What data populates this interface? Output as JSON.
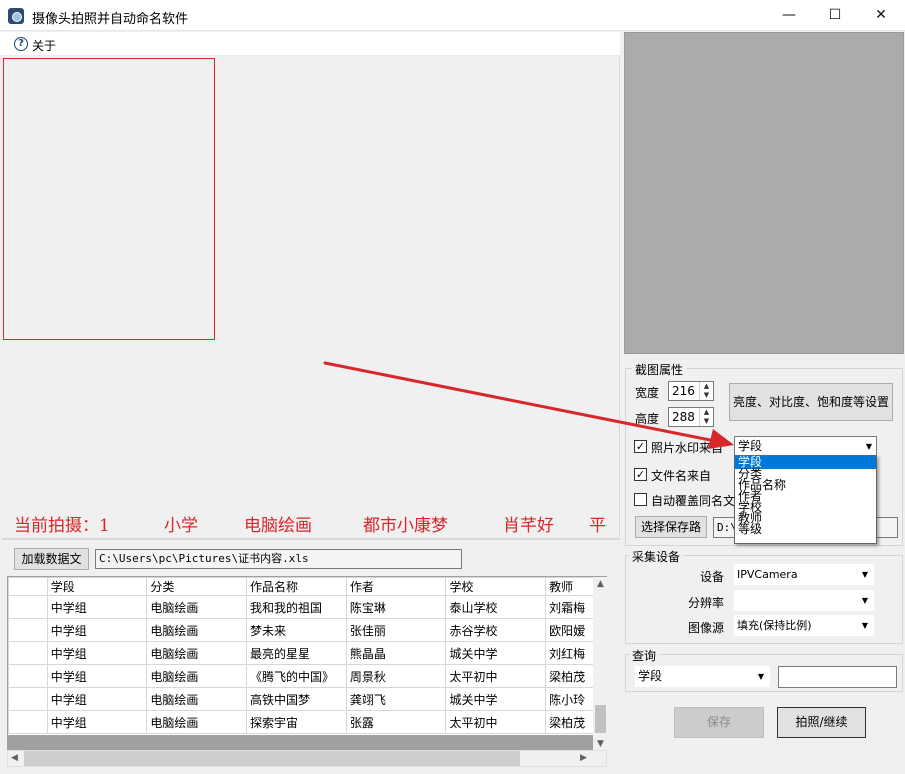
{
  "window": {
    "title": "摄像头拍照并自动命名软件",
    "controls": {
      "minimize": "—",
      "maximize": "☐",
      "close": "✕"
    }
  },
  "menu": {
    "about": "关于"
  },
  "status_line": [
    "当前拍摄：1",
    "小学",
    "电脑绘画",
    "都市小康梦",
    "肖芊好",
    "平"
  ],
  "data_load": {
    "button": "加载数据文",
    "path": "C:\\Users\\pc\\Pictures\\证书内容.xls"
  },
  "table": {
    "headers": [
      "学段",
      "分类",
      "作品名称",
      "作者",
      "学校",
      "教师"
    ],
    "rows": [
      [
        "中学组",
        "电脑绘画",
        "我和我的祖国",
        "陈宝琳",
        "泰山学校",
        "刘霜梅"
      ],
      [
        "中学组",
        "电脑绘画",
        "梦未来",
        "张佳丽",
        "赤谷学校",
        "欧阳嫒"
      ],
      [
        "中学组",
        "电脑绘画",
        "最亮的星星",
        "熊晶晶",
        "城关中学",
        "刘红梅"
      ],
      [
        "中学组",
        "电脑绘画",
        "《腾飞的中国》",
        "周景秋",
        "太平初中",
        "梁柏茂"
      ],
      [
        "中学组",
        "电脑绘画",
        "高铁中国梦",
        "龚翊飞",
        "城关中学",
        "陈小玲"
      ],
      [
        "中学组",
        "电脑绘画",
        "探索宇宙",
        "张露",
        "太平初中",
        "梁柏茂"
      ]
    ]
  },
  "crop_props": {
    "title": "截图属性",
    "width_label": "宽度",
    "width_value": "216",
    "height_label": "高度",
    "height_value": "288",
    "adjust_button": "亮度、对比度、饱和度等设置",
    "watermark_label": "照片水印来自",
    "watermark_checked": true,
    "watermark_source": "学段",
    "filename_label": "文件名来自",
    "filename_checked": true,
    "overwrite_label": "自动覆盖同名文",
    "overwrite_checked": false,
    "save_dir_button": "选择保存路",
    "save_dir_value": "D:\\"
  },
  "dropdown_options": [
    "学段",
    "分类",
    "作品名称",
    "作者",
    "学校",
    "教师",
    "等级"
  ],
  "capture_device": {
    "title": "采集设备",
    "device_label": "设备",
    "device_value": "IPVCamera",
    "resolution_label": "分辨率",
    "resolution_value": "",
    "source_label": "图像源",
    "source_value": "填充(保持比例)"
  },
  "query": {
    "title": "查询",
    "field": "学段",
    "text": ""
  },
  "actions": {
    "save": "保存",
    "shoot": "拍照/继续"
  },
  "colors": {
    "accent_red": "#d9262b",
    "selection_blue": "#0078d7"
  }
}
